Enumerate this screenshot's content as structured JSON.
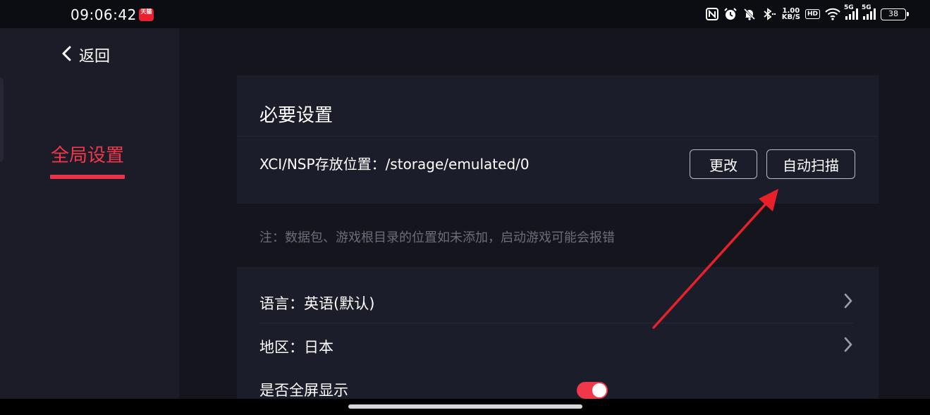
{
  "status_bar": {
    "time": "09:06:42",
    "app_badge": "天猫",
    "speed_value": "1.00",
    "speed_unit": "KB/S",
    "hd_label": "HD",
    "network_1": "5G",
    "network_2": "5G",
    "battery": "38",
    "icons": [
      "nfc-icon",
      "alarm-icon",
      "mute-icon",
      "bluetooth-icon",
      "wifi-icon",
      "signal-icon"
    ]
  },
  "sidebar": {
    "back_label": "返回",
    "items": [
      {
        "label": "全局设置",
        "active": true
      }
    ],
    "accent_color": "#f0384a"
  },
  "main": {
    "required_section": {
      "title": "必要设置",
      "storage_path": "XCI/NSP存放位置：/storage/emulated/0",
      "change_button": "更改",
      "auto_scan_button": "自动扫描"
    },
    "note": "注：数据包、游戏根目录的位置如未添加，启动游戏可能会报错",
    "settings": {
      "language": "语言：英语(默认)",
      "region": "地区：日本",
      "fullscreen": "是否全屏显示",
      "fullscreen_enabled": true
    }
  },
  "annotation": {
    "type": "arrow",
    "color": "#e8202a",
    "points_to": "自动扫描"
  }
}
